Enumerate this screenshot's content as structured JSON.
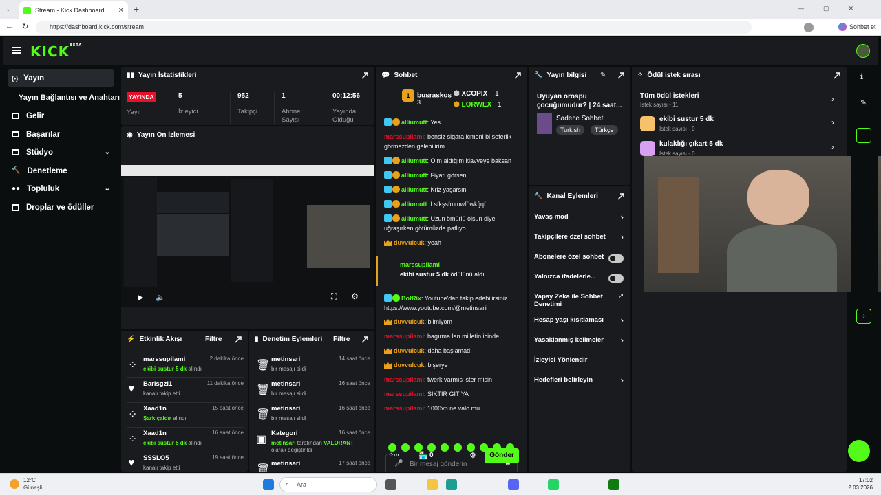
{
  "browser": {
    "tab_title": "Stream - Kick Dashboard",
    "url": "https://dashboard.kick.com/stream",
    "profile_label": "Sohbet et"
  },
  "nav": {
    "logo": "KICK",
    "logo_beta": "BETA"
  },
  "sidebar": {
    "items": [
      {
        "label": "Yayın"
      },
      {
        "label": "Yayın Bağlantısı ve Anahtarı"
      },
      {
        "label": "Gelir"
      },
      {
        "label": "Başarılar"
      },
      {
        "label": "Stüdyo"
      },
      {
        "label": "Denetleme"
      },
      {
        "label": "Topluluk"
      },
      {
        "label": "Droplar ve ödüller"
      }
    ]
  },
  "stats": {
    "title": "Yayın İstatistikleri",
    "live_badge": "YAYINDA",
    "live_label": "Yayın",
    "items": [
      {
        "value": "5",
        "label": "İzleyici"
      },
      {
        "value": "952",
        "label": "Takipçi"
      },
      {
        "value": "1",
        "label": "Abone Sayısı"
      },
      {
        "value": "00:12:56",
        "label": "Yayında Olduğu"
      }
    ]
  },
  "preview": {
    "title": "Yayın Ön İzlemesi"
  },
  "activity": {
    "title": "Etkinlik Akışı",
    "filter": "Filtre",
    "events": [
      {
        "user": "marssupilami",
        "time": "2 dakika önce",
        "highlight": "ekibi sustur 5 dk",
        "rest": " alındı"
      },
      {
        "user": "Barisgzl1",
        "time": "11 dakika önce",
        "highlight": "",
        "rest": "kanalı takip etti"
      },
      {
        "user": "Xaad1n",
        "time": "15 saat önce",
        "highlight": "Şarkıçaldır",
        "rest": " alındı"
      },
      {
        "user": "Xaad1n",
        "time": "16 saat önce",
        "highlight": "ekibi sustur 5 dk",
        "rest": " alındı"
      },
      {
        "user": "SSSLO5",
        "time": "19 saat önce",
        "highlight": "",
        "rest": "kanalı takip etti"
      }
    ]
  },
  "moderation": {
    "title": "Denetim Eylemleri",
    "filter": "Filtre",
    "events": [
      {
        "user": "metinsari",
        "time": "14 saat önce",
        "desc": "bir mesajı sildi"
      },
      {
        "user": "metinsari",
        "time": "16 saat önce",
        "desc": "bir mesajı sildi"
      },
      {
        "user": "metinsari",
        "time": "16 saat önce",
        "desc": "bir mesajı sildi"
      },
      {
        "user": "Kategori",
        "time": "16 saat önce",
        "desc_user": "metinsari",
        "desc_mid": " tarafından ",
        "desc_hl": "VALORANT",
        "desc_end": "olarak değiştirildi"
      },
      {
        "user": "metinsari",
        "time": "17 saat önce",
        "desc": ""
      }
    ]
  },
  "chat": {
    "title": "Sohbet",
    "top_gifters": [
      {
        "rank": "1",
        "name": "busraskos",
        "count": "3"
      },
      {
        "name": "XCOPIX",
        "count": "1"
      },
      {
        "name": "LORWEX",
        "count": "1"
      }
    ],
    "messages": [
      {
        "user": "alliumutt",
        "text": "Yes",
        "style": "badge"
      },
      {
        "user": "marssupilami",
        "text": "bensiz sigara icmeni bi seferlik görmezden gelebilirim",
        "style": "red"
      },
      {
        "user": "alliumutt",
        "text": "Olm aldığım klavyeye baksan",
        "style": "badge"
      },
      {
        "user": "alliumutt",
        "text": "Fiyatı görsen",
        "style": "badge"
      },
      {
        "user": "alliumutt",
        "text": "Kriz yaşarsın",
        "style": "badge"
      },
      {
        "user": "alliumutt",
        "text": "Lsfkşsfmmwföwkfjqf",
        "style": "badge"
      },
      {
        "user": "alliumutt",
        "text": "Uzun ömürlü olsun diye uğraşırken götümüzde patlıyo",
        "style": "badge"
      },
      {
        "user": "duvvulcuk",
        "text": "yeah",
        "style": "crown"
      }
    ],
    "redeem": {
      "user": "marssupilami",
      "reward": "ekibi sustur 5 dk",
      "suffix": "ödülünü aldı"
    },
    "messages2": [
      {
        "user": "BotRix",
        "text": "Youtube'dan takip edebilirsiniz",
        "link": "https://www.youtube.com/@metinsarii",
        "style": "bot"
      },
      {
        "user": "duvvulcuk",
        "text": "bilmiyom",
        "style": "crown"
      },
      {
        "user": "marssupilami",
        "text": "bagırma lan milletin icinde",
        "style": "red"
      },
      {
        "user": "duvvulcuk",
        "text": "daha başlamadı",
        "style": "crown"
      },
      {
        "user": "duvvulcuk",
        "text": "bişerye",
        "style": "crown"
      },
      {
        "user": "marssupilami",
        "text": "twerk varmıs ister misin",
        "style": "red"
      },
      {
        "user": "marssupilami",
        "text": "SİKTİR GİT YA",
        "style": "red"
      },
      {
        "user": "marssupilami",
        "text": "1000vp ne valo mu",
        "style": "red"
      }
    ],
    "input_placeholder": "Bir mesaj gönderin",
    "points": "0",
    "send": "Gönder"
  },
  "info": {
    "title": "Yayın bilgisi",
    "stream_title": "Uyuyan orospu çocuğumudur? | 24 saat...",
    "category": "Sadece Sohbet",
    "tags": [
      "Turkish",
      "Türkçe"
    ]
  },
  "channel_actions": {
    "title": "Kanal Eylemleri",
    "items": [
      {
        "label": "Yavaş mod",
        "control": "chevron"
      },
      {
        "label": "Takipçilere özel sohbet",
        "control": "chevron"
      },
      {
        "label": "Abonelere özel sohbet",
        "control": "toggle"
      },
      {
        "label": "Yalnızca ifadelerle...",
        "control": "toggle"
      },
      {
        "label": "Yapay Zeka ile Sohbet Denetimi",
        "control": "external"
      },
      {
        "label": "Hesap yaşı kısıtlaması",
        "control": "chevron"
      },
      {
        "label": "Yasaklanmış kelimeler",
        "control": "chevron"
      },
      {
        "label": "İzleyici Yönlendir",
        "control": "none"
      },
      {
        "label": "Hedefleri belirleyin",
        "control": "chevron"
      }
    ]
  },
  "rewards": {
    "title": "Ödül istek sırası",
    "all": "Tüm ödül istekleri",
    "all_count": "İstek sayısı - 11",
    "items": [
      {
        "name": "ekibi sustur 5 dk",
        "count": "İstek sayısı - 0"
      },
      {
        "name": "kulaklığı çıkart 5 dk",
        "count": "İstek sayısı - 0"
      }
    ]
  },
  "taskbar": {
    "temp": "12°C",
    "weather": "Güneşli",
    "search": "Ara",
    "time": "17:02",
    "date": "2.03.2026"
  },
  "colors": {
    "accent": "#53fc18",
    "live": "#e9112a",
    "panel": "#191b1f"
  }
}
